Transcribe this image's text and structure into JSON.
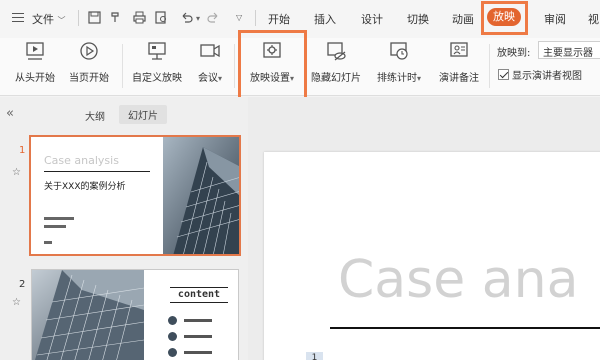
{
  "colors": {
    "accent": "#e3652f",
    "highlight_border": "#ee7a45"
  },
  "topbar": {
    "file_menu": "文件",
    "tabs": [
      "开始",
      "插入",
      "设计",
      "切换",
      "动画",
      "放映",
      "审阅",
      "视"
    ],
    "active_tab": "放映"
  },
  "ribbon": {
    "buttons": [
      {
        "label": "从头开始",
        "icon": "play-from-start-icon"
      },
      {
        "label": "当页开始",
        "icon": "play-current-icon"
      },
      {
        "label": "自定义放映",
        "icon": "custom-show-icon"
      },
      {
        "label": "会议",
        "icon": "meeting-icon"
      },
      {
        "label": "放映设置",
        "icon": "slideshow-settings-icon"
      },
      {
        "label": "隐藏幻灯片",
        "icon": "hide-slide-icon"
      },
      {
        "label": "排练计时",
        "icon": "rehearse-timing-icon"
      },
      {
        "label": "演讲备注",
        "icon": "speaker-notes-icon"
      }
    ],
    "play_to_label": "放映到:",
    "play_to_value": "主要显示器",
    "presenter_view_label": "显示演讲者视图",
    "presenter_view_checked": true
  },
  "left_panel": {
    "tabs": [
      "大纲",
      "幻灯片"
    ],
    "active_tab": "幻灯片",
    "slides": [
      {
        "number": "1",
        "ghost_title": "Case analysis",
        "title": "关于XXX的案例分析"
      },
      {
        "number": "2",
        "heading": "content"
      }
    ]
  },
  "main": {
    "slide_ghost_title": "Case ana",
    "page_marker": "1"
  }
}
